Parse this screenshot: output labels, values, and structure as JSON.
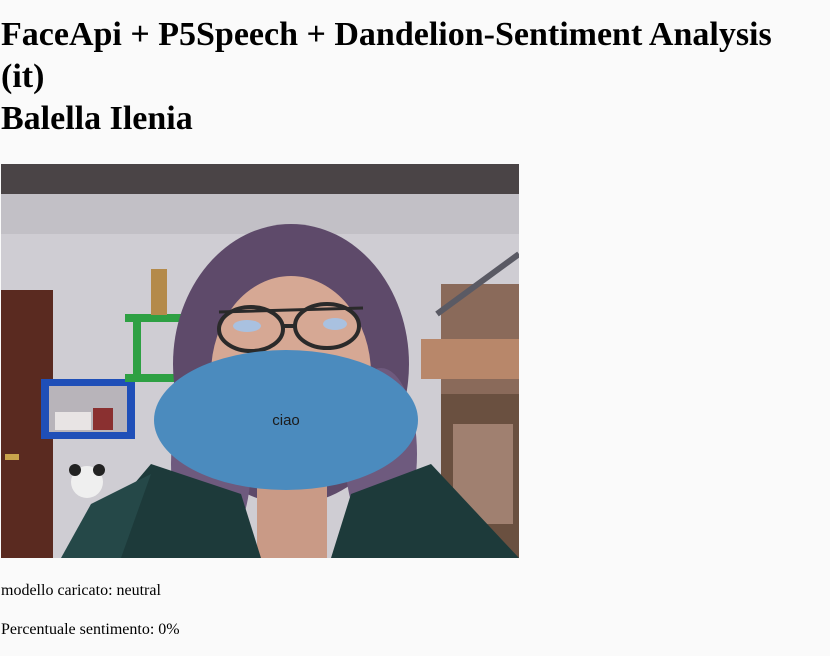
{
  "header": {
    "title_line1": "FaceApi + P5Speech + Dandelion-Sentiment Analysis",
    "title_line2": "(it)",
    "author": "Balella Ilenia"
  },
  "canvas": {
    "speech_text": "ciao",
    "bubble_color": "#4b8bbe"
  },
  "status": {
    "model_label": "modello caricato:",
    "model_value": "neutral",
    "model_line": "modello caricato: neutral",
    "sentiment_label": "Percentuale sentimento:",
    "sentiment_value": "0%",
    "sentiment_line": "Percentuale sentimento: 0%"
  }
}
